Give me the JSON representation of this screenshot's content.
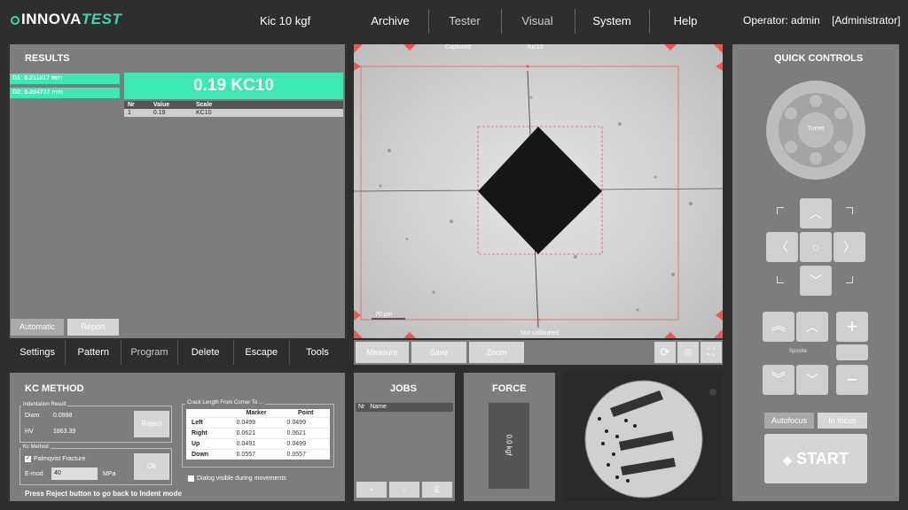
{
  "app": {
    "logo_main": "INNOVA",
    "logo_accent": "TEST",
    "title": "Kic 10 kgf",
    "operator": "Operator: admin",
    "role": "[Administrator]"
  },
  "nav": [
    "Archive",
    "Tester",
    "Visual",
    "System",
    "Help"
  ],
  "results": {
    "heading": "RESULTS",
    "d1": "D1: 0.211817 mm",
    "d2": "D2: 0.204737 mm",
    "big": "0.19 KC10",
    "cols": [
      "Nr",
      "Value",
      "Scale"
    ],
    "rows": [
      [
        "1",
        "0.19",
        "KC10"
      ]
    ],
    "automatic": "Automatic",
    "report": "Report"
  },
  "toolbar": [
    "Settings",
    "Pattern",
    "Program",
    "Delete",
    "Escape",
    "Tools"
  ],
  "image": {
    "top_left": "Captured",
    "top_right": "Kic10",
    "scale": "70 μm",
    "bottom": "Not calibrated",
    "measure": "Measure",
    "save": "Save",
    "zoom": "Zoom"
  },
  "kc": {
    "heading": "KC METHOD",
    "ind_group": "Indentation Result",
    "diam_l": "Diam",
    "diam_v": "0.0998",
    "hv_l": "HV",
    "hv_v": "1863.39",
    "reject": "Reject",
    "method_group": "Kc Method",
    "palmqvist": "Palmqvist Fracture",
    "emod_l": "E-mod",
    "emod_v": "40",
    "emod_u": "MPa",
    "ok": "Ok",
    "crack_group": "Crack Length From Corner To ...",
    "crack_cols": [
      "",
      "Marker",
      "Point"
    ],
    "crack_rows": [
      [
        "Left",
        "0.0499",
        "0.0499"
      ],
      [
        "Right",
        "0.0621",
        "0.0621"
      ],
      [
        "Up",
        "0.0491",
        "0.0499"
      ],
      [
        "Down",
        "0.0557",
        "0.0557"
      ]
    ],
    "dialog": "Dialog visible during movements",
    "hint": "Press Reject button to go back to Indent mode"
  },
  "jobs": {
    "heading": "JOBS",
    "cols": [
      "Nr",
      "Name"
    ],
    "add": "+",
    "remove": "-",
    "edit": "E"
  },
  "force": {
    "heading": "FORCE",
    "value": "0.0 kgf"
  },
  "quick": {
    "heading": "QUICK CONTROLS",
    "turret": "Turret",
    "spindle": "Spindle",
    "autofocus": "Autofocus",
    "infocus": "In focus",
    "start": "START"
  },
  "colors": {
    "accent": "#3ee8b4",
    "panel": "#7d7d7d",
    "bg": "#2e2e2e"
  }
}
